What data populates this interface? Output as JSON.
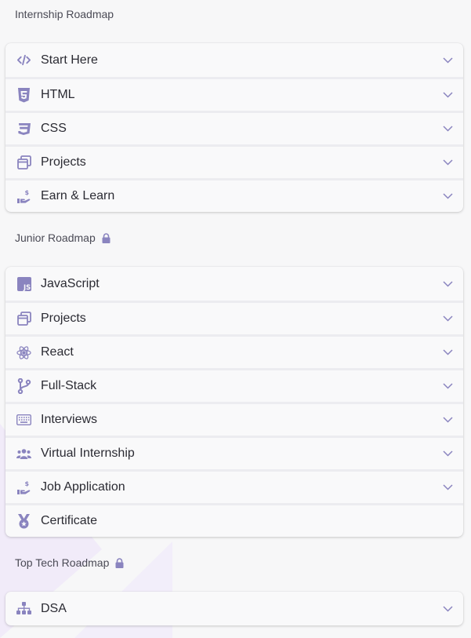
{
  "accent_color": "#8a84bf",
  "sections": [
    {
      "title": "Internship Roadmap",
      "locked": false,
      "items": [
        {
          "label": "Start Here",
          "icon": "code-icon",
          "expandable": true
        },
        {
          "label": "HTML",
          "icon": "html5-icon",
          "expandable": true
        },
        {
          "label": "CSS",
          "icon": "css3-icon",
          "expandable": true
        },
        {
          "label": "Projects",
          "icon": "windows-stack-icon",
          "expandable": true
        },
        {
          "label": "Earn & Learn",
          "icon": "hand-coin-icon",
          "expandable": true
        }
      ]
    },
    {
      "title": "Junior Roadmap",
      "locked": true,
      "items": [
        {
          "label": "JavaScript",
          "icon": "js-icon",
          "expandable": true
        },
        {
          "label": "Projects",
          "icon": "windows-stack-icon",
          "expandable": true
        },
        {
          "label": "React",
          "icon": "react-atom-icon",
          "expandable": true
        },
        {
          "label": "Full-Stack",
          "icon": "git-branch-icon",
          "expandable": true
        },
        {
          "label": "Interviews",
          "icon": "keyboard-icon",
          "expandable": true
        },
        {
          "label": "Virtual Internship",
          "icon": "users-group-icon",
          "expandable": true
        },
        {
          "label": "Job Application",
          "icon": "hand-coin-icon",
          "expandable": true
        },
        {
          "label": "Certificate",
          "icon": "medal-icon",
          "expandable": false
        }
      ]
    },
    {
      "title": "Top Tech Roadmap",
      "locked": true,
      "items": [
        {
          "label": "DSA",
          "icon": "sitemap-icon",
          "expandable": true
        }
      ]
    }
  ]
}
